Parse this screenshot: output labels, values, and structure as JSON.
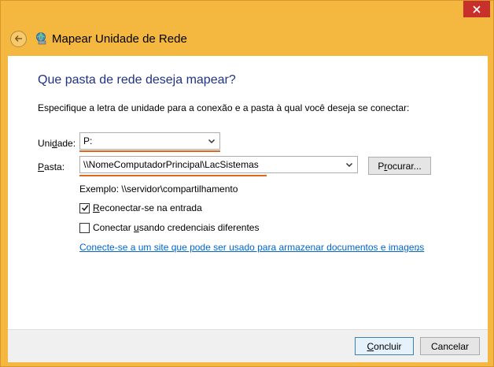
{
  "window": {
    "title": "Mapear Unidade de Rede"
  },
  "page": {
    "heading": "Que pasta de rede deseja mapear?",
    "instruction": "Especifique a letra de unidade para a conexão e a pasta à qual você deseja se conectar:"
  },
  "drive": {
    "label_pre": "Uni",
    "label_u": "d",
    "label_post": "ade:",
    "value": "P:"
  },
  "folder": {
    "label_u": "P",
    "label_post": "asta:",
    "value": "\\\\NomeComputadorPrincipal\\LacSistemas",
    "browse_pre": "P",
    "browse_u": "r",
    "browse_post": "ocurar..."
  },
  "example": "Exemplo: \\\\servidor\\compartilhamento",
  "options": {
    "reconnect_u": "R",
    "reconnect_post": "econectar-se na entrada",
    "reconnect_checked": true,
    "credentials_pre": "Conectar ",
    "credentials_u": "u",
    "credentials_post": "sando credenciais diferentes",
    "credentials_checked": false
  },
  "link": {
    "text": "Conecte-se a um site que pode ser usado para armazenar documentos e imagens",
    "trailing": "."
  },
  "footer": {
    "finish_u": "C",
    "finish_post": "oncluir",
    "cancel": "Cancelar"
  },
  "colors": {
    "frame": "#f4b73f",
    "heading": "#1e3287",
    "link": "#0066cc",
    "highlight_underline": "#e0661a",
    "close": "#c7302b"
  },
  "icons": {
    "back": "back-arrow-icon",
    "app": "network-drive-icon",
    "close": "close-icon",
    "dropdown": "chevron-down-icon",
    "check": "checkmark-icon"
  }
}
